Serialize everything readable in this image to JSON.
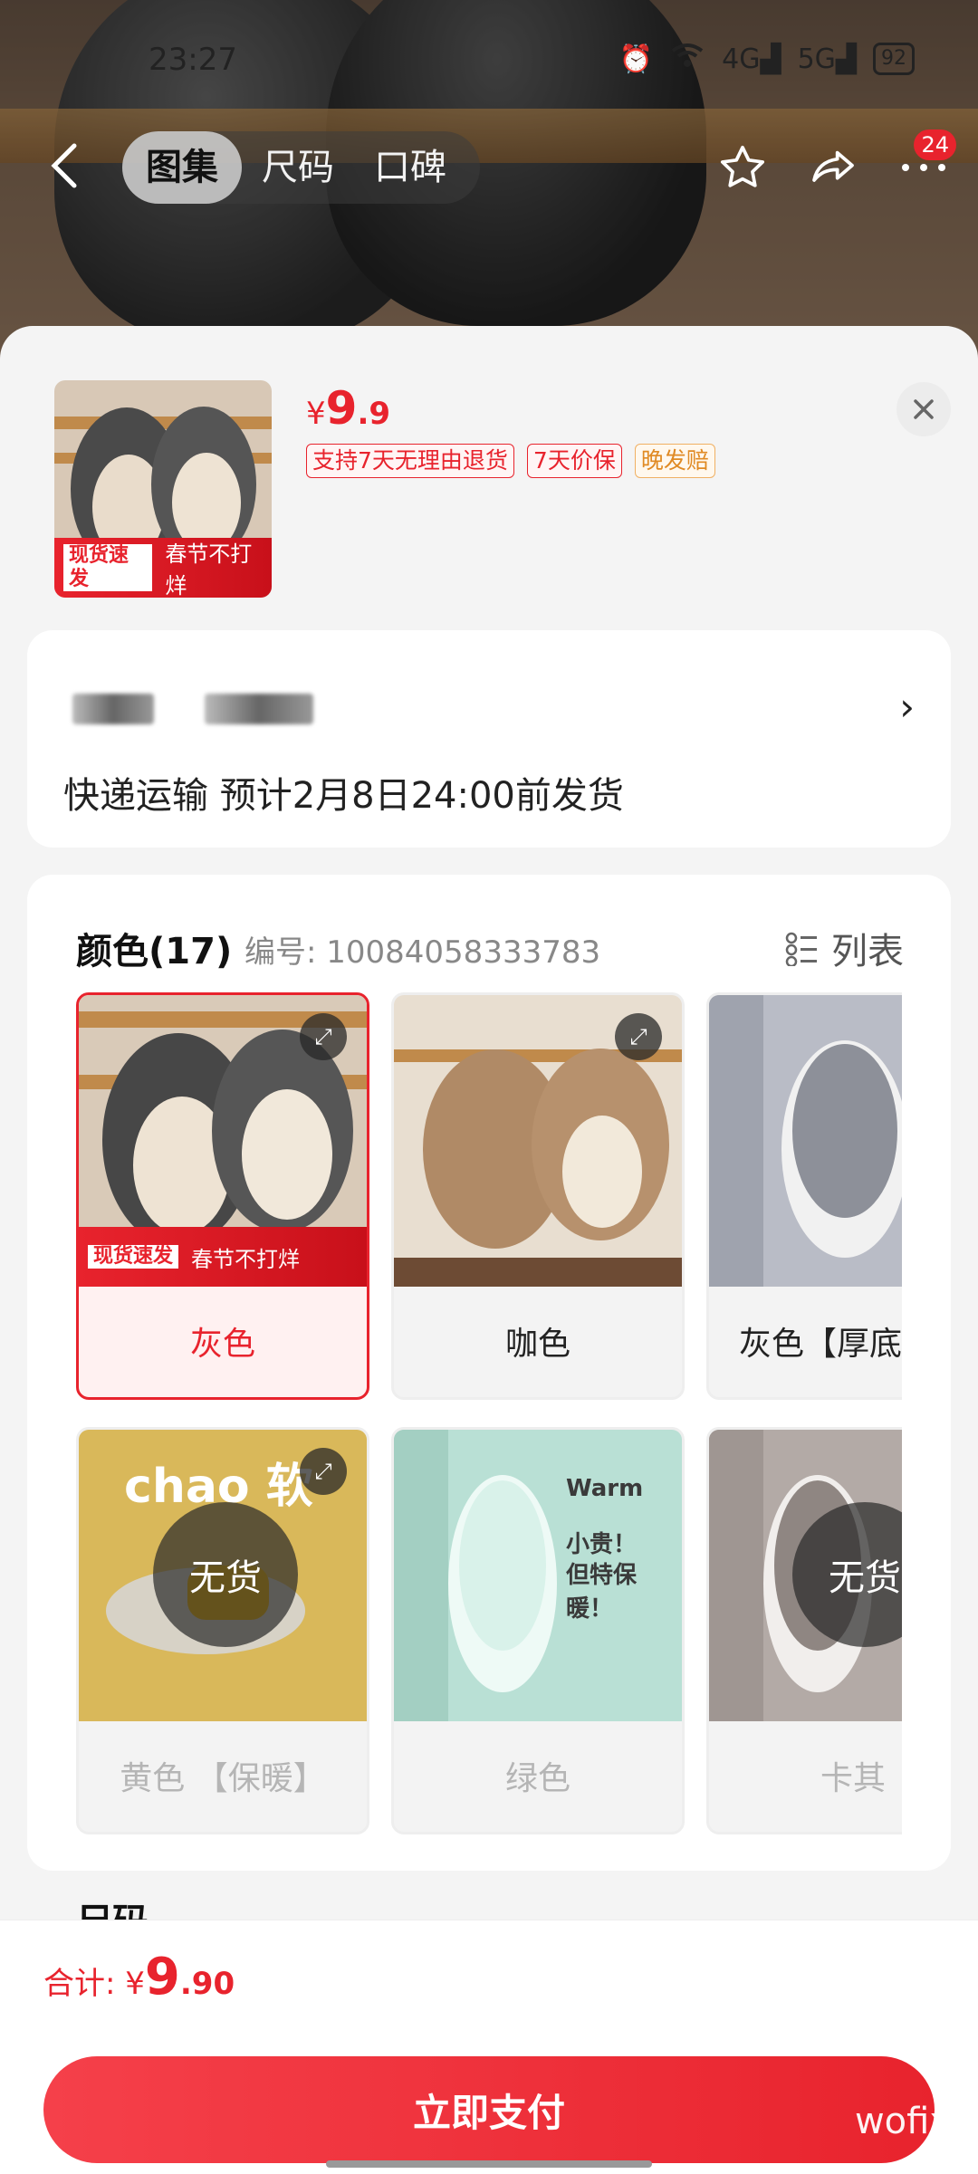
{
  "status_bar": {
    "time": "23:27",
    "battery": "92",
    "net1": "4G",
    "net2": "5G"
  },
  "nav": {
    "tabs": [
      {
        "label": "图集"
      },
      {
        "label": "尺码"
      },
      {
        "label": "口碑"
      }
    ],
    "cart_badge": "24"
  },
  "product": {
    "price_symbol": "¥",
    "price_integer": "9",
    "price_decimal": ".9",
    "tags": [
      "支持7天无理由退货",
      "7天价保",
      "晚发赔"
    ],
    "thumb_ribbon": {
      "left": "现货速发",
      "right": "春节不打烊"
    }
  },
  "delivery": {
    "shipping_text": "快递运输 预计2月8日24:00前发货"
  },
  "color_section": {
    "title": "颜色(17)",
    "code_label": "编号: 10084058333783",
    "list_label": "列表",
    "options": [
      {
        "label": "灰色",
        "selected": true,
        "available": true
      },
      {
        "label": "咖色",
        "selected": false,
        "available": true
      },
      {
        "label": "灰色【厚底暖】",
        "selected": false,
        "available": true
      },
      {
        "label": "黄色 【保暖】",
        "selected": false,
        "available": false
      },
      {
        "label": "绿色",
        "selected": false,
        "available": false
      },
      {
        "label": "卡其",
        "selected": false,
        "available": false
      }
    ],
    "soldout_label": "无货",
    "yellow_brand": "chao 软",
    "warm_card": {
      "brand": "Warm",
      "line1": "小贵！",
      "line2": "但特保暖！"
    }
  },
  "size_section": {
    "title": "尺码"
  },
  "footer": {
    "total_label": "合计: ",
    "total_symbol": "¥",
    "total_integer": "9",
    "total_decimal": ".90",
    "pay_button": "立即支付"
  },
  "watermark": "wofix",
  "colors": {
    "accent": "#e8232d",
    "tag_orange": "#e08a24"
  }
}
